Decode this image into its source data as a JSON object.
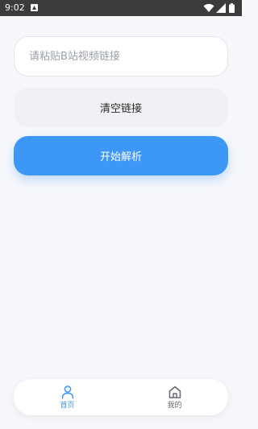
{
  "status_bar": {
    "time": "9:02",
    "icons": [
      "app-notification-icon",
      "wifi-icon",
      "signal-icon",
      "battery-icon"
    ]
  },
  "link_input": {
    "value": "",
    "placeholder": "请粘贴B站视频链接"
  },
  "buttons": {
    "clear_label": "清空链接",
    "parse_label": "开始解析"
  },
  "bottom_nav": {
    "items": [
      {
        "label": "首页",
        "icon": "user-icon",
        "active": true
      },
      {
        "label": "我的",
        "icon": "home-icon",
        "active": false
      }
    ]
  },
  "colors": {
    "accent": "#3c97f7",
    "background": "#f6f7fb",
    "status_bar": "#3b3b3b",
    "clear_button": "#f0f1f4",
    "inactive_text": "#666a70"
  }
}
